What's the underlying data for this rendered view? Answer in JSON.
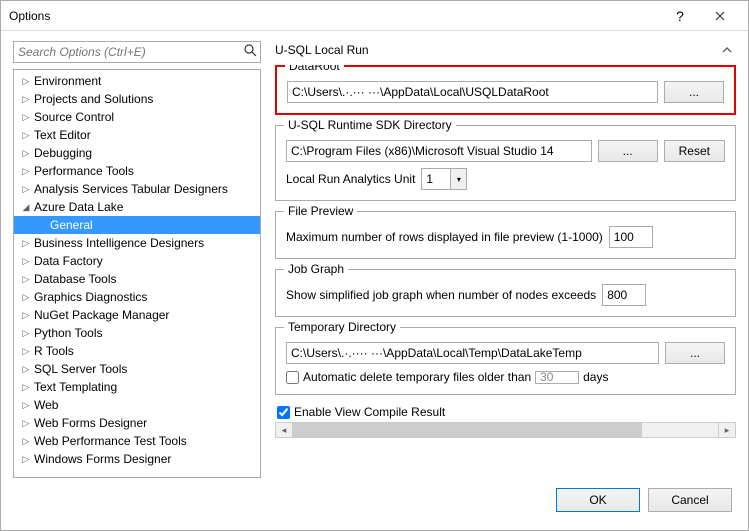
{
  "window": {
    "title": "Options"
  },
  "search": {
    "placeholder": "Search Options (Ctrl+E)"
  },
  "tree": {
    "items": [
      {
        "label": "Environment",
        "expandable": true
      },
      {
        "label": "Projects and Solutions",
        "expandable": true
      },
      {
        "label": "Source Control",
        "expandable": true
      },
      {
        "label": "Text Editor",
        "expandable": true
      },
      {
        "label": "Debugging",
        "expandable": true
      },
      {
        "label": "Performance Tools",
        "expandable": true
      },
      {
        "label": "Analysis Services Tabular Designers",
        "expandable": true
      },
      {
        "label": "Azure Data Lake",
        "expandable": true,
        "expanded": true,
        "children": [
          {
            "label": "General",
            "selected": true
          }
        ]
      },
      {
        "label": "Business Intelligence Designers",
        "expandable": true
      },
      {
        "label": "Data Factory",
        "expandable": true
      },
      {
        "label": "Database Tools",
        "expandable": true
      },
      {
        "label": "Graphics Diagnostics",
        "expandable": true
      },
      {
        "label": "NuGet Package Manager",
        "expandable": true
      },
      {
        "label": "Python Tools",
        "expandable": true
      },
      {
        "label": "R Tools",
        "expandable": true
      },
      {
        "label": "SQL Server Tools",
        "expandable": true
      },
      {
        "label": "Text Templating",
        "expandable": true
      },
      {
        "label": "Web",
        "expandable": true
      },
      {
        "label": "Web Forms Designer",
        "expandable": true
      },
      {
        "label": "Web Performance Test Tools",
        "expandable": true
      },
      {
        "label": "Windows Forms Designer",
        "expandable": true
      }
    ]
  },
  "settings": {
    "heading": "U-SQL Local Run",
    "dataroot": {
      "legend": "DataRoot",
      "value": "C:\\Users\\.·.··· ···\\AppData\\Local\\USQLDataRoot",
      "browse": "..."
    },
    "runtime": {
      "legend": "U-SQL Runtime SDK Directory",
      "value": "C:\\Program Files (x86)\\Microsoft Visual Studio 14",
      "browse": "...",
      "reset": "Reset",
      "unit_label": "Local Run Analytics Unit",
      "unit_value": "1"
    },
    "preview": {
      "legend": "File Preview",
      "label": "Maximum number of rows displayed in file preview (1-1000)",
      "value": "100"
    },
    "jobgraph": {
      "legend": "Job Graph",
      "label": "Show simplified job graph when number of nodes exceeds",
      "value": "800"
    },
    "tempdir": {
      "legend": "Temporary Directory",
      "value": "C:\\Users\\.·.···· ···\\AppData\\Local\\Temp\\DataLakeTemp",
      "browse": "...",
      "auto_label_pre": "Automatic delete temporary files older than",
      "auto_value": "30",
      "auto_label_post": "days"
    },
    "enable_compile": "Enable View Compile Result"
  },
  "footer": {
    "ok": "OK",
    "cancel": "Cancel"
  }
}
